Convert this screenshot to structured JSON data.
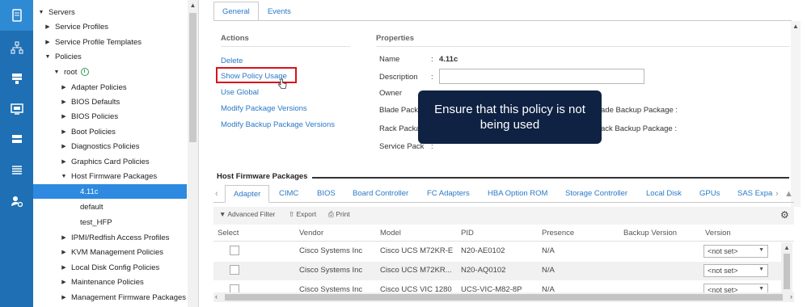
{
  "rail": {
    "items": [
      {
        "icon": "servers-icon",
        "active": true
      },
      {
        "icon": "network-icon",
        "active": false
      },
      {
        "icon": "storage-icon",
        "active": false
      },
      {
        "icon": "vm-icon",
        "active": false
      },
      {
        "icon": "chassis-icon",
        "active": false
      },
      {
        "icon": "list-icon",
        "active": false
      },
      {
        "icon": "admin-icon",
        "active": false
      }
    ]
  },
  "tree": {
    "servers": "Servers",
    "service_profiles": "Service Profiles",
    "service_profile_templates": "Service Profile Templates",
    "policies": "Policies",
    "root": "root",
    "adapter_policies": "Adapter Policies",
    "bios_defaults": "BIOS Defaults",
    "bios_policies": "BIOS Policies",
    "boot_policies": "Boot Policies",
    "diagnostics_policies": "Diagnostics Policies",
    "graphics_card_policies": "Graphics Card Policies",
    "host_firmware_packages": "Host Firmware Packages",
    "pkg_411c": "4.11c",
    "pkg_default": "default",
    "pkg_test_hfp": "test_HFP",
    "ipmi_redfish": "IPMI/Redfish Access Profiles",
    "kvm_management": "KVM Management Policies",
    "local_disk_config": "Local Disk Config Policies",
    "maintenance_policies": "Maintenance Policies",
    "management_firmware": "Management Firmware Packages"
  },
  "tabs": {
    "general": "General",
    "events": "Events"
  },
  "actions": {
    "title": "Actions",
    "delete": "Delete",
    "show_policy_usage": "Show Policy Usage",
    "use_global": "Use Global",
    "modify_package_versions": "Modify Package Versions",
    "modify_backup_package_versions": "Modify Backup Package Versions"
  },
  "properties": {
    "title": "Properties",
    "name_label": "Name",
    "name_colon": ":",
    "name_value": "4.11c",
    "description_label": "Description",
    "description_colon": ":",
    "description_value": "",
    "owner_label": "Owner",
    "blade_package_label": "Blade Pack",
    "blade_backup_label": "ade Backup Package :",
    "rack_package_label": "Rack Packa",
    "rack_backup_label": "ack Backup Package :",
    "service_pack_label": "Service Pack",
    "service_pack_colon": ":"
  },
  "tooltip": {
    "text": "Ensure that this policy is not being used"
  },
  "hfp": {
    "title": "Host Firmware Packages",
    "subtabs": [
      "Adapter",
      "CIMC",
      "BIOS",
      "Board Controller",
      "FC Adapters",
      "HBA Option ROM",
      "Storage Controller",
      "Local Disk",
      "GPUs",
      "SAS Expa"
    ]
  },
  "toolbar": {
    "advanced_filter": "Advanced Filter",
    "export": "Export",
    "print": "Print"
  },
  "table": {
    "headers": {
      "select": "Select",
      "vendor": "Vendor",
      "model": "Model",
      "pid": "PID",
      "presence": "Presence",
      "backup_version": "Backup Version",
      "version": "Version"
    },
    "rows": [
      {
        "vendor": "Cisco Systems Inc",
        "model": "Cisco UCS M72KR-E",
        "pid": "N20-AE0102",
        "presence": "N/A",
        "version": "<not set>"
      },
      {
        "vendor": "Cisco Systems Inc",
        "model": "Cisco UCS M72KR...",
        "pid": "N20-AQ0102",
        "presence": "N/A",
        "version": "<not set>"
      },
      {
        "vendor": "Cisco Systems Inc",
        "model": "Cisco UCS VIC 1280",
        "pid": "UCS-VIC-M82-8P",
        "presence": "N/A",
        "version": "<not set>"
      }
    ]
  },
  "colors": {
    "rail_bg": "#1e6fb4",
    "selected_bg": "#2d8ae0",
    "link": "#2a78c6",
    "highlight": "#d7141b",
    "tooltip_bg": "#0f2243"
  }
}
